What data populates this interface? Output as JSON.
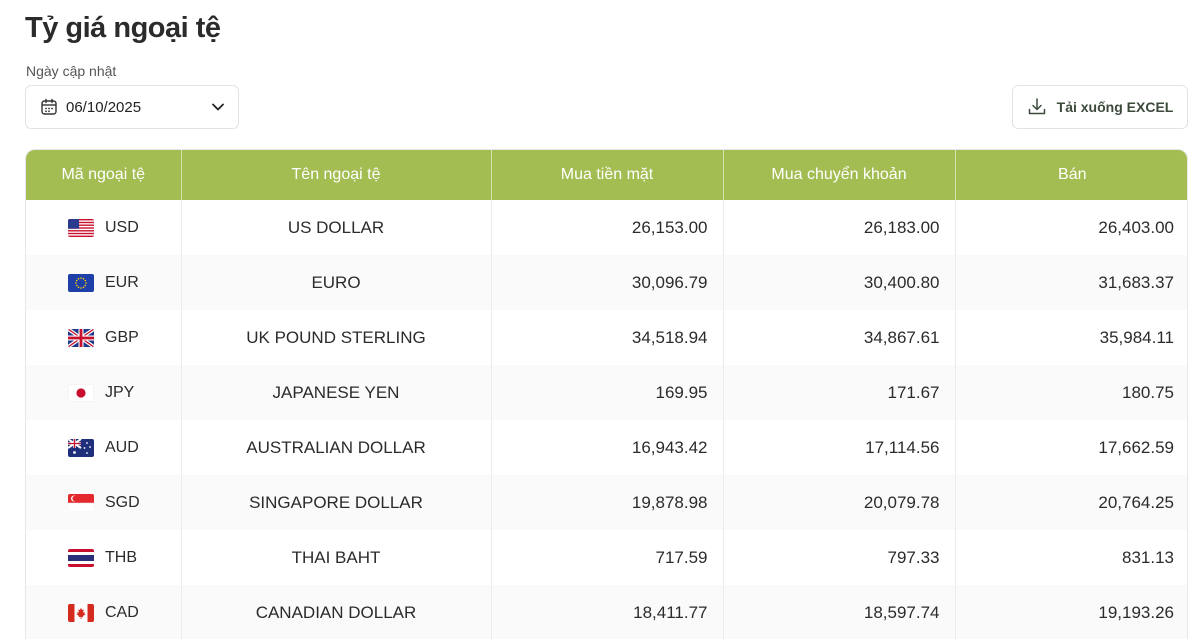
{
  "page": {
    "title": "Tỷ giá ngoại tệ"
  },
  "date_picker": {
    "label": "Ngày cập nhật",
    "value": "06/10/2025"
  },
  "excel_button": {
    "label": "Tải xuống EXCEL"
  },
  "table": {
    "headers": [
      "Mã ngoại tệ",
      "Tên ngoại tệ",
      "Mua tiền mặt",
      "Mua chuyển khoản",
      "Bán"
    ],
    "rows": [
      {
        "code": "USD",
        "flag_icon": "us-flag-icon",
        "name": "US DOLLAR",
        "cash": "26,153.00",
        "transfer": "26,183.00",
        "sell": "26,403.00"
      },
      {
        "code": "EUR",
        "flag_icon": "eu-flag-icon",
        "name": "EURO",
        "cash": "30,096.79",
        "transfer": "30,400.80",
        "sell": "31,683.37"
      },
      {
        "code": "GBP",
        "flag_icon": "uk-flag-icon",
        "name": "UK POUND STERLING",
        "cash": "34,518.94",
        "transfer": "34,867.61",
        "sell": "35,984.11"
      },
      {
        "code": "JPY",
        "flag_icon": "jp-flag-icon",
        "name": "JAPANESE YEN",
        "cash": "169.95",
        "transfer": "171.67",
        "sell": "180.75"
      },
      {
        "code": "AUD",
        "flag_icon": "au-flag-icon",
        "name": "AUSTRALIAN DOLLAR",
        "cash": "16,943.42",
        "transfer": "17,114.56",
        "sell": "17,662.59"
      },
      {
        "code": "SGD",
        "flag_icon": "sg-flag-icon",
        "name": "SINGAPORE DOLLAR",
        "cash": "19,878.98",
        "transfer": "20,079.78",
        "sell": "20,764.25"
      },
      {
        "code": "THB",
        "flag_icon": "th-flag-icon",
        "name": "THAI BAHT",
        "cash": "717.59",
        "transfer": "797.33",
        "sell": "831.13"
      },
      {
        "code": "CAD",
        "flag_icon": "ca-flag-icon",
        "name": "CANADIAN DOLLAR",
        "cash": "18,411.77",
        "transfer": "18,597.74",
        "sell": "19,193.26"
      }
    ]
  },
  "colors": {
    "header_bg": "#a3bd52",
    "header_text": "#ffffff"
  }
}
